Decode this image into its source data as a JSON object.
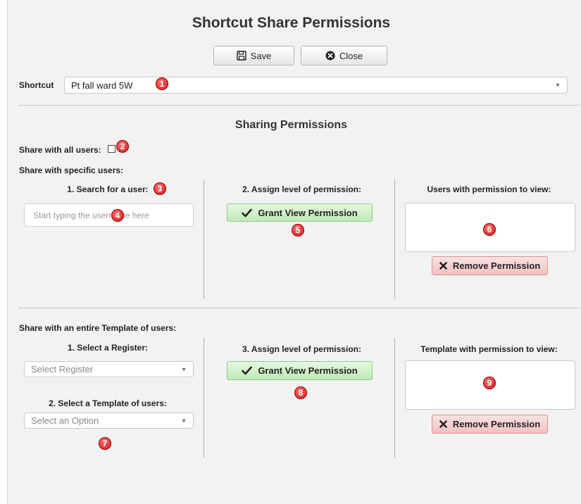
{
  "dialog": {
    "title": "Shortcut Share Permissions",
    "save_label": "Save",
    "close_label": "Close"
  },
  "shortcut": {
    "label": "Shortcut",
    "value": "Pt fall ward 5W"
  },
  "sharing": {
    "heading": "Sharing Permissions",
    "share_all_label": "Share with all users:",
    "share_all_checked": false,
    "specific_label": "Share with specific users:",
    "search_label": "1. Search for a user:",
    "search_placeholder": "Start typing the username here",
    "assign_label": "2. Assign level of permission:",
    "grant_label": "Grant View Permission",
    "users_label": "Users with permission to view:",
    "remove_label": "Remove Permission"
  },
  "template": {
    "heading": "Share with an entire Template of users:",
    "register_label": "1. Select a Register:",
    "register_placeholder": "Select Register",
    "template_label": "2. Select a Template of users:",
    "template_placeholder": "Select an Option",
    "assign_label": "3. Assign level of permission:",
    "grant_label": "Grant View Permission",
    "template_list_label": "Template with permission to view:",
    "remove_label": "Remove Permission"
  },
  "badges": [
    "1",
    "2",
    "3",
    "4",
    "5",
    "6",
    "7",
    "8",
    "9"
  ],
  "colors": {
    "badge": "#d42020",
    "grant_bg": "#c8ecbf",
    "remove_bg": "#f4c8c8",
    "dialog_bg": "#f2f2f2"
  }
}
